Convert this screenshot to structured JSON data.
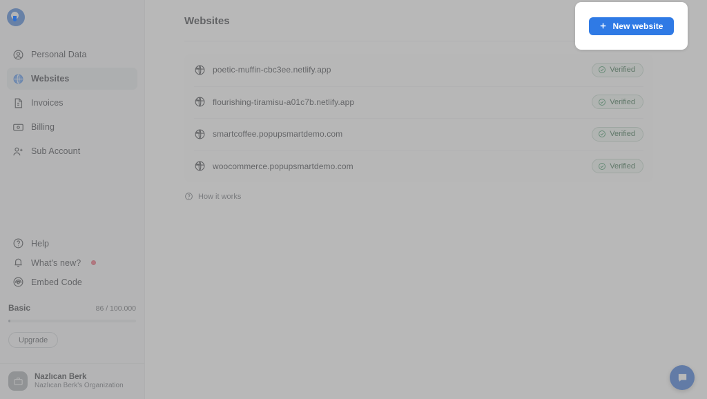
{
  "brand": {
    "logo_icon": "popupsmart-logo-icon",
    "accent_color": "#2f7ae5",
    "dim_overlay_color": "#8c8c8c",
    "verified_color": "#17542f",
    "notification_dot_color": "#f0566c"
  },
  "sidebar": {
    "items": [
      {
        "label": "Personal Data",
        "icon": "user-circle-icon",
        "active": false
      },
      {
        "label": "Websites",
        "icon": "globe-icon",
        "active": true
      },
      {
        "label": "Invoices",
        "icon": "document-icon",
        "active": false
      },
      {
        "label": "Billing",
        "icon": "billing-card-icon",
        "active": false
      },
      {
        "label": "Sub Account",
        "icon": "user-add-icon",
        "active": false
      }
    ],
    "bottom_items": [
      {
        "label": "Help",
        "icon": "question-circle-icon",
        "has_dot": false
      },
      {
        "label": "What's new?",
        "icon": "bell-icon",
        "has_dot": true
      },
      {
        "label": "Embed Code",
        "icon": "embed-code-icon",
        "has_dot": false
      }
    ],
    "plan": {
      "name": "Basic",
      "quota": "86 / 100.000",
      "progress_percent": 1.5,
      "upgrade_label": "Upgrade"
    },
    "user": {
      "name": "Nazlıcan Berk",
      "organization": "Nazlıcan Berk's Organization",
      "avatar_icon": "briefcase-icon"
    }
  },
  "header": {
    "title": "Websites",
    "new_website_label": "New website",
    "new_website_icon": "plus-icon"
  },
  "main": {
    "websites": [
      {
        "name": "poetic-muffin-cbc3ee.netlify.app",
        "status": "Verified",
        "icon": "globe-icon",
        "action_icon": "row-menu-icon"
      },
      {
        "name": "flourishing-tiramisu-a01c7b.netlify.app",
        "status": "Verified",
        "icon": "globe-icon",
        "action_icon": "row-menu-icon"
      },
      {
        "name": "smartcoffee.popupsmartdemo.com",
        "status": "Verified",
        "icon": "globe-icon",
        "action_icon": "row-menu-icon"
      },
      {
        "name": "woocommerce.popupsmartdemo.com",
        "status": "Verified",
        "icon": "globe-icon",
        "action_icon": "row-menu-icon"
      }
    ],
    "status_icon": "check-circle-icon",
    "how_it_works_label": "How it works",
    "how_it_works_icon": "question-circle-icon"
  },
  "chat": {
    "launcher_icon": "chat-bubble-icon"
  }
}
